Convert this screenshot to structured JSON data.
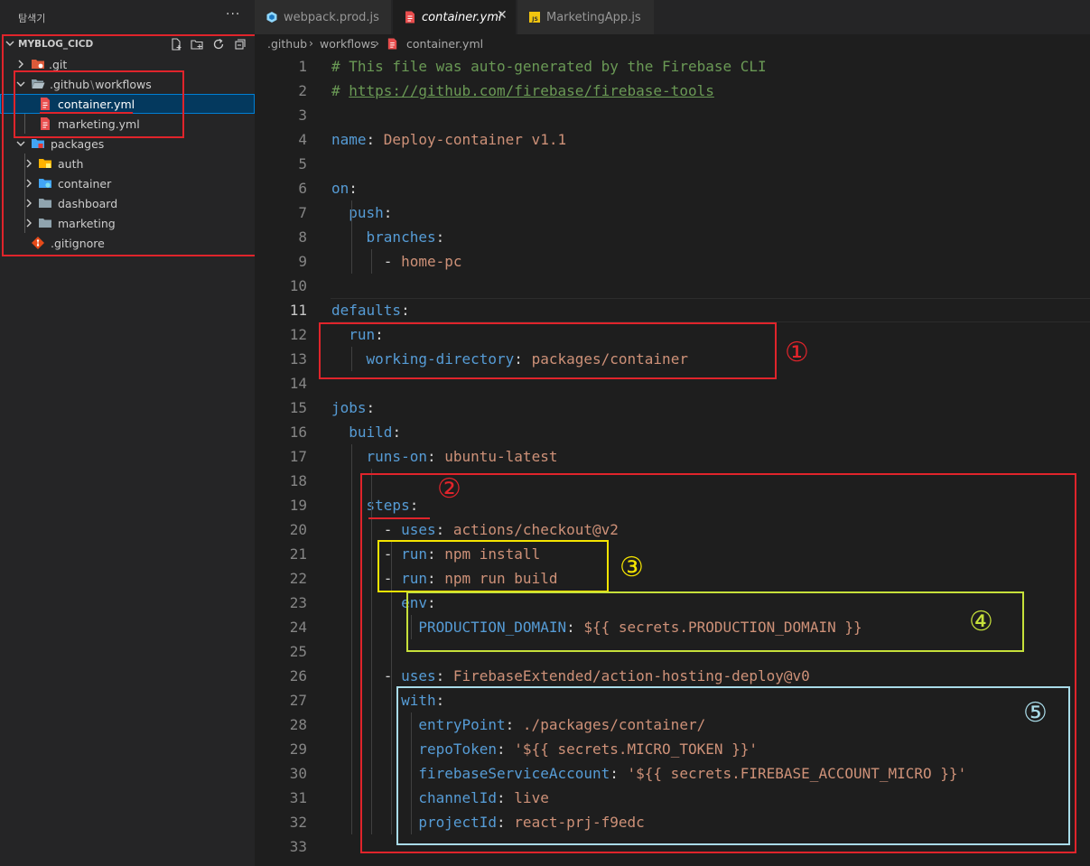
{
  "sidebar": {
    "title": "탐색기",
    "more_label": "···",
    "project_name": "MYBLOG_CICD",
    "actions": [
      "new-file-icon",
      "new-folder-icon",
      "refresh-icon",
      "collapse-all-icon"
    ],
    "items": [
      {
        "label": ".git",
        "type": "folder",
        "expanded": false,
        "icon": "git-folder-icon"
      },
      {
        "label_parts": [
          ".github",
          "\\",
          "workflows"
        ],
        "type": "folder",
        "expanded": true,
        "icon": "folder-open-icon"
      },
      {
        "label": "container.yml",
        "type": "file",
        "icon": "yaml-file-icon",
        "selected": true
      },
      {
        "label": "marketing.yml",
        "type": "file",
        "icon": "yaml-file-icon"
      },
      {
        "label": "packages",
        "type": "folder",
        "expanded": true,
        "icon": "packages-folder-icon"
      },
      {
        "label": "auth",
        "type": "folder",
        "expanded": false,
        "icon": "auth-folder-icon"
      },
      {
        "label": "container",
        "type": "folder",
        "expanded": false,
        "icon": "container-folder-icon"
      },
      {
        "label": "dashboard",
        "type": "folder",
        "expanded": false,
        "icon": "folder-icon"
      },
      {
        "label": "marketing",
        "type": "folder",
        "expanded": false,
        "icon": "folder-icon"
      },
      {
        "label": ".gitignore",
        "type": "file",
        "icon": "git-file-icon"
      }
    ]
  },
  "tabs": [
    {
      "label": "webpack.prod.js",
      "icon": "webpack-icon",
      "active": false
    },
    {
      "label": "container.yml",
      "icon": "yaml-file-icon",
      "active": true,
      "close": "✕"
    },
    {
      "label": "MarketingApp.js",
      "icon": "js-file-icon",
      "active": false
    }
  ],
  "breadcrumb": [
    ".github",
    "workflows",
    "container.yml"
  ],
  "breadcrumb_sep": "›",
  "editor": {
    "active_line": 11,
    "lines": [
      {
        "n": "1",
        "tokens": [
          [
            "comment",
            "# This file was auto-generated by the Firebase CLI"
          ]
        ]
      },
      {
        "n": "2",
        "tokens": [
          [
            "comment",
            "# "
          ],
          [
            "link",
            "https://github.com/firebase/firebase-tools"
          ]
        ]
      },
      {
        "n": "3",
        "tokens": []
      },
      {
        "n": "4",
        "tokens": [
          [
            "key",
            "name"
          ],
          [
            "punc",
            ": "
          ],
          [
            "str",
            "Deploy-container v1.1"
          ]
        ]
      },
      {
        "n": "5",
        "tokens": []
      },
      {
        "n": "6",
        "tokens": [
          [
            "key",
            "on"
          ],
          [
            "punc",
            ":"
          ]
        ]
      },
      {
        "n": "7",
        "tokens": [
          [
            "key",
            "  push"
          ],
          [
            "punc",
            ":"
          ]
        ]
      },
      {
        "n": "8",
        "tokens": [
          [
            "key",
            "    branches"
          ],
          [
            "punc",
            ":"
          ]
        ]
      },
      {
        "n": "9",
        "tokens": [
          [
            "punc",
            "      - "
          ],
          [
            "str",
            "home-pc"
          ]
        ]
      },
      {
        "n": "10",
        "tokens": []
      },
      {
        "n": "11",
        "tokens": [
          [
            "key",
            "defaults"
          ],
          [
            "punc",
            ":"
          ]
        ]
      },
      {
        "n": "12",
        "tokens": [
          [
            "key",
            "  run"
          ],
          [
            "punc",
            ":"
          ]
        ]
      },
      {
        "n": "13",
        "tokens": [
          [
            "key",
            "    working-directory"
          ],
          [
            "punc",
            ": "
          ],
          [
            "str",
            "packages/container"
          ]
        ]
      },
      {
        "n": "14",
        "tokens": []
      },
      {
        "n": "15",
        "tokens": [
          [
            "key",
            "jobs"
          ],
          [
            "punc",
            ":"
          ]
        ]
      },
      {
        "n": "16",
        "tokens": [
          [
            "key",
            "  build"
          ],
          [
            "punc",
            ":"
          ]
        ]
      },
      {
        "n": "17",
        "tokens": [
          [
            "key",
            "    runs-on"
          ],
          [
            "punc",
            ": "
          ],
          [
            "str",
            "ubuntu-latest"
          ]
        ]
      },
      {
        "n": "18",
        "tokens": []
      },
      {
        "n": "19",
        "tokens": [
          [
            "key",
            "    steps"
          ],
          [
            "punc",
            ":"
          ]
        ]
      },
      {
        "n": "20",
        "tokens": [
          [
            "punc",
            "      - "
          ],
          [
            "key",
            "uses"
          ],
          [
            "punc",
            ": "
          ],
          [
            "str",
            "actions/checkout@v2"
          ]
        ]
      },
      {
        "n": "21",
        "tokens": [
          [
            "punc",
            "      - "
          ],
          [
            "key",
            "run"
          ],
          [
            "punc",
            ": "
          ],
          [
            "str",
            "npm install"
          ]
        ]
      },
      {
        "n": "22",
        "tokens": [
          [
            "punc",
            "      - "
          ],
          [
            "key",
            "run"
          ],
          [
            "punc",
            ": "
          ],
          [
            "str",
            "npm run build"
          ]
        ]
      },
      {
        "n": "23",
        "tokens": [
          [
            "key",
            "        env"
          ],
          [
            "punc",
            ":"
          ]
        ]
      },
      {
        "n": "24",
        "tokens": [
          [
            "key",
            "          PRODUCTION_DOMAIN"
          ],
          [
            "punc",
            ": "
          ],
          [
            "str",
            "${{ secrets.PRODUCTION_DOMAIN }}"
          ]
        ]
      },
      {
        "n": "25",
        "tokens": []
      },
      {
        "n": "26",
        "tokens": [
          [
            "punc",
            "      - "
          ],
          [
            "key",
            "uses"
          ],
          [
            "punc",
            ": "
          ],
          [
            "str",
            "FirebaseExtended/action-hosting-deploy@v0"
          ]
        ]
      },
      {
        "n": "27",
        "tokens": [
          [
            "key",
            "        with"
          ],
          [
            "punc",
            ":"
          ]
        ]
      },
      {
        "n": "28",
        "tokens": [
          [
            "key",
            "          entryPoint"
          ],
          [
            "punc",
            ": "
          ],
          [
            "str",
            "./packages/container/"
          ]
        ]
      },
      {
        "n": "29",
        "tokens": [
          [
            "key",
            "          repoToken"
          ],
          [
            "punc",
            ": "
          ],
          [
            "str",
            "'${{ secrets.MICRO_TOKEN }}'"
          ]
        ]
      },
      {
        "n": "30",
        "tokens": [
          [
            "key",
            "          firebaseServiceAccount"
          ],
          [
            "punc",
            ": "
          ],
          [
            "str",
            "'${{ secrets.FIREBASE_ACCOUNT_MICRO }}'"
          ]
        ]
      },
      {
        "n": "31",
        "tokens": [
          [
            "key",
            "          channelId"
          ],
          [
            "punc",
            ": "
          ],
          [
            "str",
            "live"
          ]
        ]
      },
      {
        "n": "32",
        "tokens": [
          [
            "key",
            "          projectId"
          ],
          [
            "punc",
            ": "
          ],
          [
            "str",
            "react-prj-f9edc"
          ]
        ]
      },
      {
        "n": "33",
        "tokens": []
      }
    ]
  },
  "annotations": [
    {
      "label": "①",
      "color": "#e0242b"
    },
    {
      "label": "②",
      "color": "#e0242b"
    },
    {
      "label": "③",
      "color": "#f5e400"
    },
    {
      "label": "④",
      "color": "#c6e03a"
    },
    {
      "label": "⑤",
      "color": "#a9dbe8"
    }
  ],
  "colors": {
    "annotation_red": "#e0242b",
    "annotation_yellow": "#f5e400",
    "annotation_lime": "#c6e03a",
    "annotation_cyan": "#a9dbe8",
    "selection": "#04395e",
    "yaml_key": "#569cd6",
    "yaml_string": "#ce9178",
    "comment": "#6a9955"
  }
}
